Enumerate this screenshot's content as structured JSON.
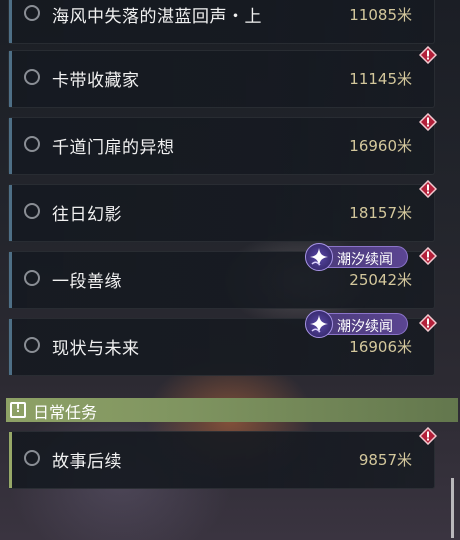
{
  "quests": [
    {
      "name": "海风中失落的湛蓝回声・上",
      "distance": "11085米",
      "alert": false,
      "tag": null
    },
    {
      "name": "卡带收藏家",
      "distance": "11145米",
      "alert": true,
      "tag": null
    },
    {
      "name": "千道门扉的异想",
      "distance": "16960米",
      "alert": true,
      "tag": null
    },
    {
      "name": "往日幻影",
      "distance": "18157米",
      "alert": true,
      "tag": null
    },
    {
      "name": "一段善缘",
      "distance": "25042米",
      "alert": true,
      "tag": "潮汐续闻"
    },
    {
      "name": "现状与未来",
      "distance": "16906米",
      "alert": true,
      "tag": "潮汐续闻"
    }
  ],
  "daily_section": {
    "title": "日常任务",
    "quests": [
      {
        "name": "故事后续",
        "distance": "9857米",
        "alert": true,
        "tag": null
      }
    ]
  },
  "colors": {
    "card_accent_story": "#4e6f86",
    "card_accent_daily": "#97a868",
    "distance_text": "#d3c79c",
    "alert_red": "#b3203a",
    "tag_purple": "#5b4592"
  },
  "icons": {
    "alert": "exclamation-diamond-icon",
    "tag": "tide-sparkle-icon",
    "section": "exclamation-square-icon"
  }
}
